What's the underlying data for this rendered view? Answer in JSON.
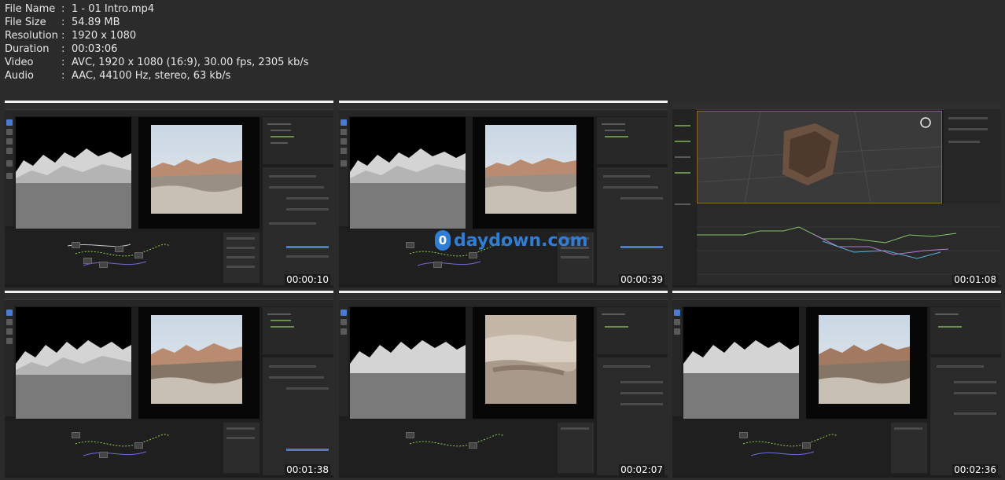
{
  "file_info": [
    {
      "key": "File Name",
      "value": "1 - 01 Intro.mp4"
    },
    {
      "key": "File Size",
      "value": "54.89 MB"
    },
    {
      "key": "Resolution",
      "value": "1920 x 1080"
    },
    {
      "key": "Duration",
      "value": "00:03:06"
    },
    {
      "key": "Video",
      "value": "AVC, 1920 x 1080 (16:9), 30.00 fps, 2305 kb/s"
    },
    {
      "key": "Audio",
      "value": "AAC, 44100 Hz, stereo, 63 kb/s"
    }
  ],
  "separator": ":",
  "watermark": {
    "badge": "0",
    "text": "daydown.com"
  },
  "thumbnails": [
    {
      "timestamp": "00:00:10",
      "kind": "blender"
    },
    {
      "timestamp": "00:00:39",
      "kind": "blender"
    },
    {
      "timestamp": "00:01:08",
      "kind": "graph"
    },
    {
      "timestamp": "00:01:38",
      "kind": "blender"
    },
    {
      "timestamp": "00:02:07",
      "kind": "blender-blur"
    },
    {
      "timestamp": "00:02:36",
      "kind": "blender"
    }
  ]
}
